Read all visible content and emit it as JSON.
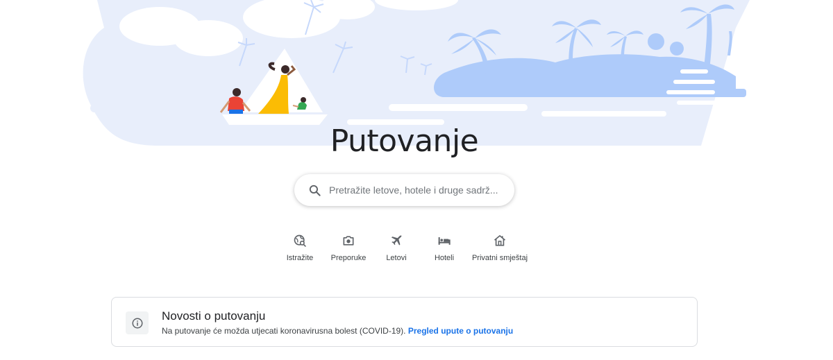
{
  "page": {
    "title": "Putovanje"
  },
  "search": {
    "placeholder": "Pretražite letove, hotele i druge sadrž..."
  },
  "nav": [
    {
      "label": "Istražite",
      "icon": "explore-globe-icon"
    },
    {
      "label": "Preporuke",
      "icon": "camera-icon"
    },
    {
      "label": "Letovi",
      "icon": "airplane-icon"
    },
    {
      "label": "Hoteli",
      "icon": "bed-icon"
    },
    {
      "label": "Privatni smještaj",
      "icon": "house-icon"
    }
  ],
  "news": {
    "title": "Novosti o putovanju",
    "text": "Na putovanje će možda utjecati koronavirusna bolest (COVID-19).",
    "link": "Pregled upute o putovanju"
  },
  "colors": {
    "hero_light": "#e8eefb",
    "hero_blue": "#aecbfa",
    "link": "#1a73e8"
  }
}
